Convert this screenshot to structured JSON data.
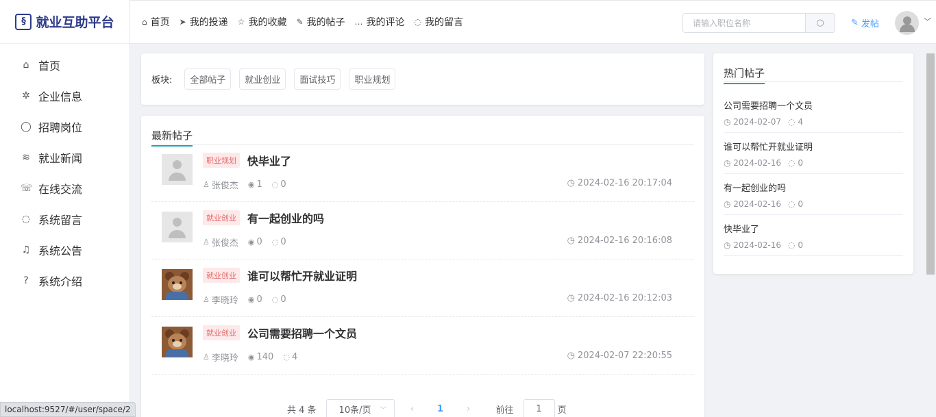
{
  "app": {
    "logo_glyph": "§",
    "name": "就业互助平台"
  },
  "sidebar": {
    "items": [
      {
        "icon": "home-icon",
        "glyph": "⌂",
        "label": "首页"
      },
      {
        "icon": "yelp-icon",
        "glyph": "✲",
        "label": "企业信息"
      },
      {
        "icon": "bubble-icon",
        "glyph": "◯",
        "label": "招聘岗位"
      },
      {
        "icon": "rss-icon",
        "glyph": "≋",
        "label": "就业新闻"
      },
      {
        "icon": "chat-icon",
        "glyph": "☏",
        "label": "在线交流"
      },
      {
        "icon": "comment-icon",
        "glyph": "◌",
        "label": "系统留言"
      },
      {
        "icon": "bell-icon",
        "glyph": "♫",
        "label": "系统公告"
      },
      {
        "icon": "question-icon",
        "glyph": "?",
        "label": "系统介绍"
      }
    ]
  },
  "topnav": {
    "items": [
      {
        "icon": "home-icon",
        "glyph": "⌂",
        "label": "首页"
      },
      {
        "icon": "send-icon",
        "glyph": "➤",
        "label": "我的投递"
      },
      {
        "icon": "star-icon",
        "glyph": "☆",
        "label": "我的收藏"
      },
      {
        "icon": "edit-icon",
        "glyph": "✎",
        "label": "我的帖子"
      },
      {
        "icon": "chat-icon",
        "glyph": "…",
        "label": "我的评论"
      },
      {
        "icon": "comment-icon",
        "glyph": "◌",
        "label": "我的留言"
      }
    ],
    "search_placeholder": "请输入职位名称",
    "post_label": "发帖"
  },
  "sections": {
    "label": "板块:",
    "tags": [
      "全部帖子",
      "就业创业",
      "面试技巧",
      "职业规划"
    ]
  },
  "latest": {
    "title": "最新帖子",
    "posts": [
      {
        "tag": "职业规划",
        "title": "快毕业了",
        "author": "张俊杰",
        "views": "1",
        "comments": "0",
        "time": "2024-02-16 20:17:04",
        "avatar": "placeholder"
      },
      {
        "tag": "就业创业",
        "title": "有一起创业的吗",
        "author": "张俊杰",
        "views": "0",
        "comments": "0",
        "time": "2024-02-16 20:16:08",
        "avatar": "placeholder"
      },
      {
        "tag": "就业创业",
        "title": "谁可以帮忙开就业证明",
        "author": "李晓玲",
        "views": "0",
        "comments": "0",
        "time": "2024-02-16 20:12:03",
        "avatar": "bear"
      },
      {
        "tag": "就业创业",
        "title": "公司需要招聘一个文员",
        "author": "李晓玲",
        "views": "140",
        "comments": "4",
        "time": "2024-02-07 22:20:55",
        "avatar": "bear"
      }
    ]
  },
  "pagination": {
    "total": "共 4 条",
    "page_size": "10条/页",
    "current": "1",
    "goto": "前往",
    "goto_value": "1",
    "page_unit": "页"
  },
  "hot": {
    "title": "热门帖子",
    "posts": [
      {
        "title": "公司需要招聘一个文员",
        "date": "2024-02-07",
        "comments": "4"
      },
      {
        "title": "谁可以帮忙开就业证明",
        "date": "2024-02-16",
        "comments": "0"
      },
      {
        "title": "有一起创业的吗",
        "date": "2024-02-16",
        "comments": "0"
      },
      {
        "title": "快毕业了",
        "date": "2024-02-16",
        "comments": "0"
      }
    ]
  },
  "status_bar": {
    "url": "localhost:9527/#/user/space/2"
  },
  "colors": {
    "brand": "#2d3a8c",
    "accent": "#1aa6b7",
    "link": "#409eff",
    "tag_bg": "#fde9e9",
    "tag_text": "#e56a6a"
  }
}
